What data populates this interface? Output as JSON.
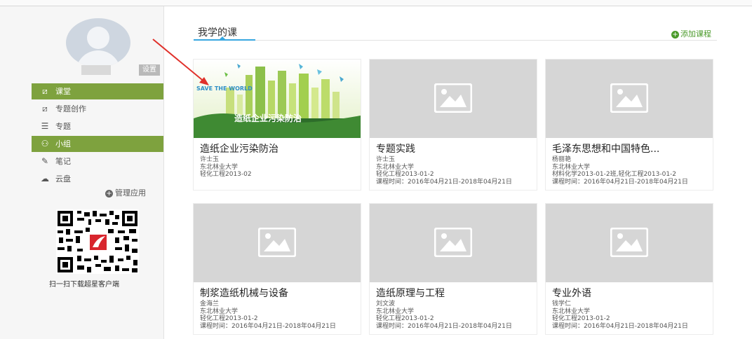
{
  "sidebar": {
    "settings_label": "设置",
    "nav": [
      {
        "label": "课堂",
        "icon": "classroom-icon",
        "active": true
      },
      {
        "label": "专题创作",
        "icon": "topic-create-icon",
        "active": false
      },
      {
        "label": "专题",
        "icon": "topic-icon",
        "active": false
      },
      {
        "label": "小组",
        "icon": "group-icon",
        "active": true
      },
      {
        "label": "笔记",
        "icon": "note-icon",
        "active": false
      },
      {
        "label": "云盘",
        "icon": "cloud-icon",
        "active": false
      }
    ],
    "manage_label": "管理应用",
    "qr_caption": "扫一扫下载超星客户端"
  },
  "main": {
    "title": "我学的课",
    "add_course_label": "添加课程",
    "courses": [
      {
        "title": "造纸企业污染防治",
        "teacher": "许士玉",
        "school": "东北林业大学",
        "class": "轻化工程2013-02",
        "time": "",
        "image": "save-the-world-banner",
        "banner_text": "造纸企业污染防治",
        "banner_slogan": "SAVE THE WORLD"
      },
      {
        "title": "专题实践",
        "teacher": "许士玉",
        "school": "东北林业大学",
        "class": "轻化工程2013-01-2",
        "time": "课程时间：2016年04月21日-2018年04月21日"
      },
      {
        "title": "毛泽东思想和中国特色...",
        "teacher": "杨丽艳",
        "school": "东北林业大学",
        "class": "材料化学2013-01-2班,轻化工程2013-01-2",
        "time": "课程时间：2016年04月21日-2018年04月21日"
      },
      {
        "title": "制浆造纸机械与设备",
        "teacher": "金海兰",
        "school": "东北林业大学",
        "class": "轻化工程2013-01-2",
        "time": "课程时间：2016年04月21日-2018年04月21日"
      },
      {
        "title": "造纸原理与工程",
        "teacher": "刘文波",
        "school": "东北林业大学",
        "class": "轻化工程2013-01-2",
        "time": "课程时间：2016年04月21日-2018年04月21日"
      },
      {
        "title": "专业外语",
        "teacher": "钱学仁",
        "school": "东北林业大学",
        "class": "轻化工程2013-01-2",
        "time": "课程时间：2016年04月21日-2018年04月21日"
      }
    ]
  },
  "colors": {
    "accent_green": "#7ea23e",
    "tab_blue": "#38a7e0",
    "add_green": "#4a9a2a",
    "annotation_red": "#e0302a"
  }
}
